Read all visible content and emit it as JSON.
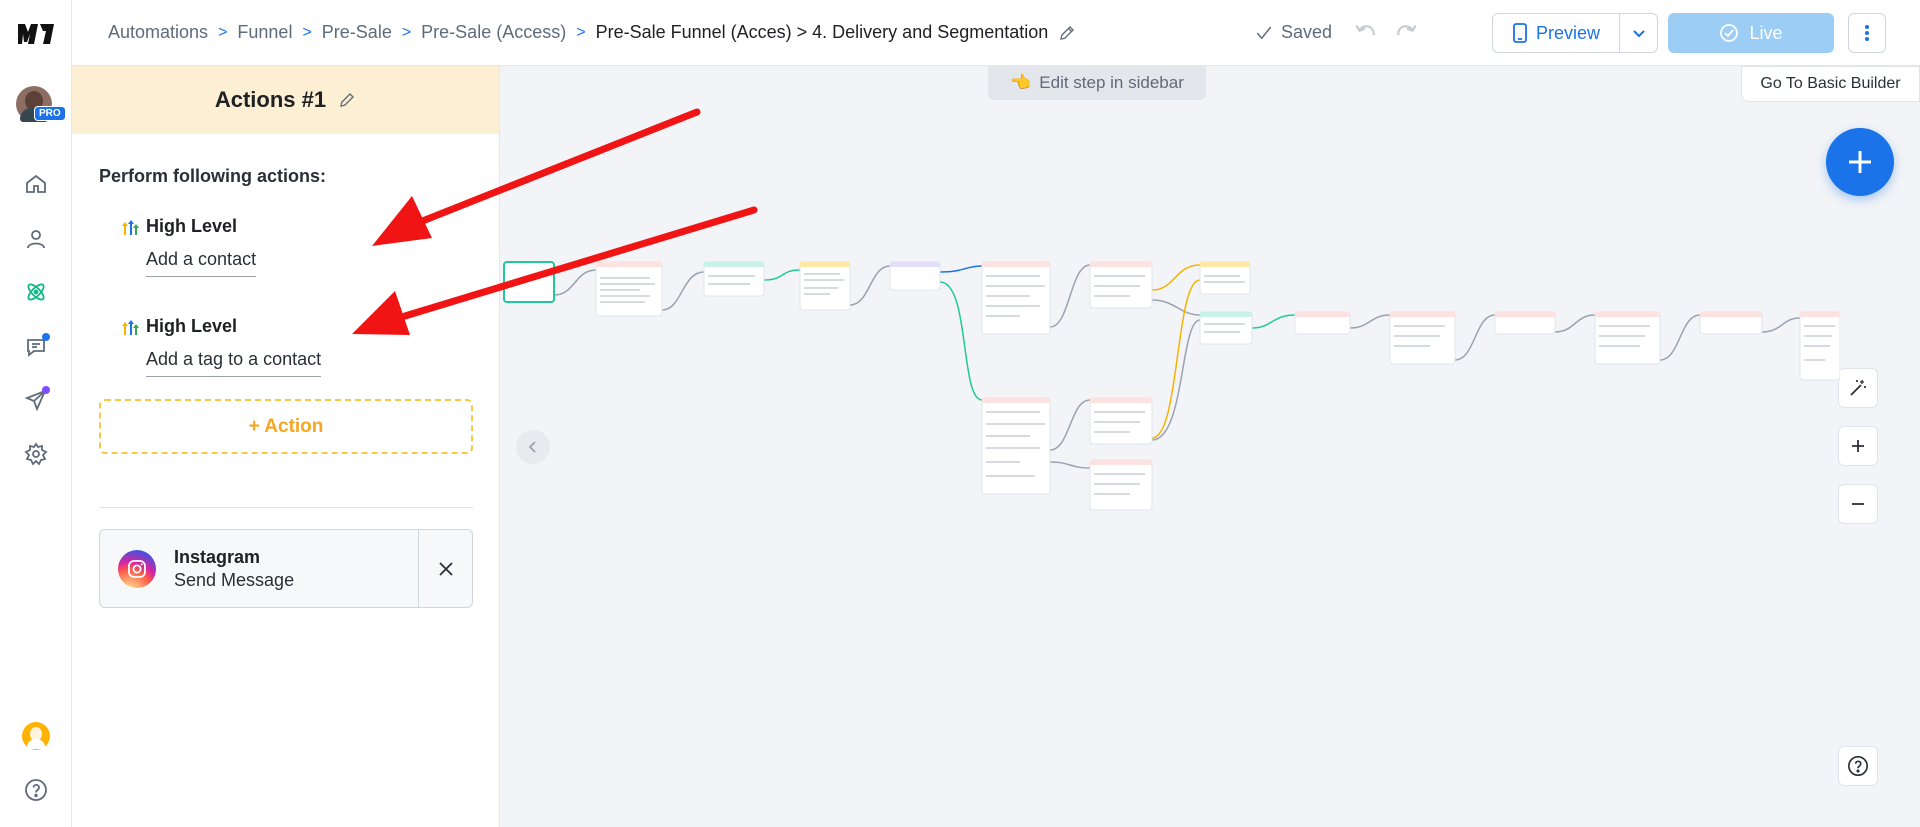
{
  "breadcrumbs": [
    "Automations",
    "Funnel",
    "Pre-Sale",
    "Pre-Sale (Access)",
    "Pre-Sale Funnel (Acces) > 4. Delivery and Segmentation"
  ],
  "topbar": {
    "saved_label": "Saved",
    "preview_label": "Preview",
    "live_label": "Live"
  },
  "rail": {
    "pro_badge": "PRO",
    "icons": [
      "home-icon",
      "contacts-icon",
      "automation-icon",
      "chat-icon",
      "broadcast-icon",
      "settings-icon",
      "help-icon"
    ]
  },
  "panel": {
    "title": "Actions #1",
    "subtitle": "Perform following actions:",
    "actions": [
      {
        "provider": "High Level",
        "description": "Add a contact"
      },
      {
        "provider": "High Level",
        "description": "Add a tag to a contact"
      }
    ],
    "add_action_label": "+ Action",
    "next_step": {
      "title": "Instagram",
      "subtitle": "Send Message"
    }
  },
  "canvas": {
    "edit_step_label": "Edit step in sidebar",
    "basic_builder_label": "Go To Basic Builder"
  },
  "colors": {
    "accent": "#1a73e8",
    "live_disabled": "#9ccdf5",
    "panel_header": "#fdefd3",
    "add_action_border": "#f7c948",
    "annotation_arrow": "#f01414",
    "automation_icon": "#12b886"
  }
}
